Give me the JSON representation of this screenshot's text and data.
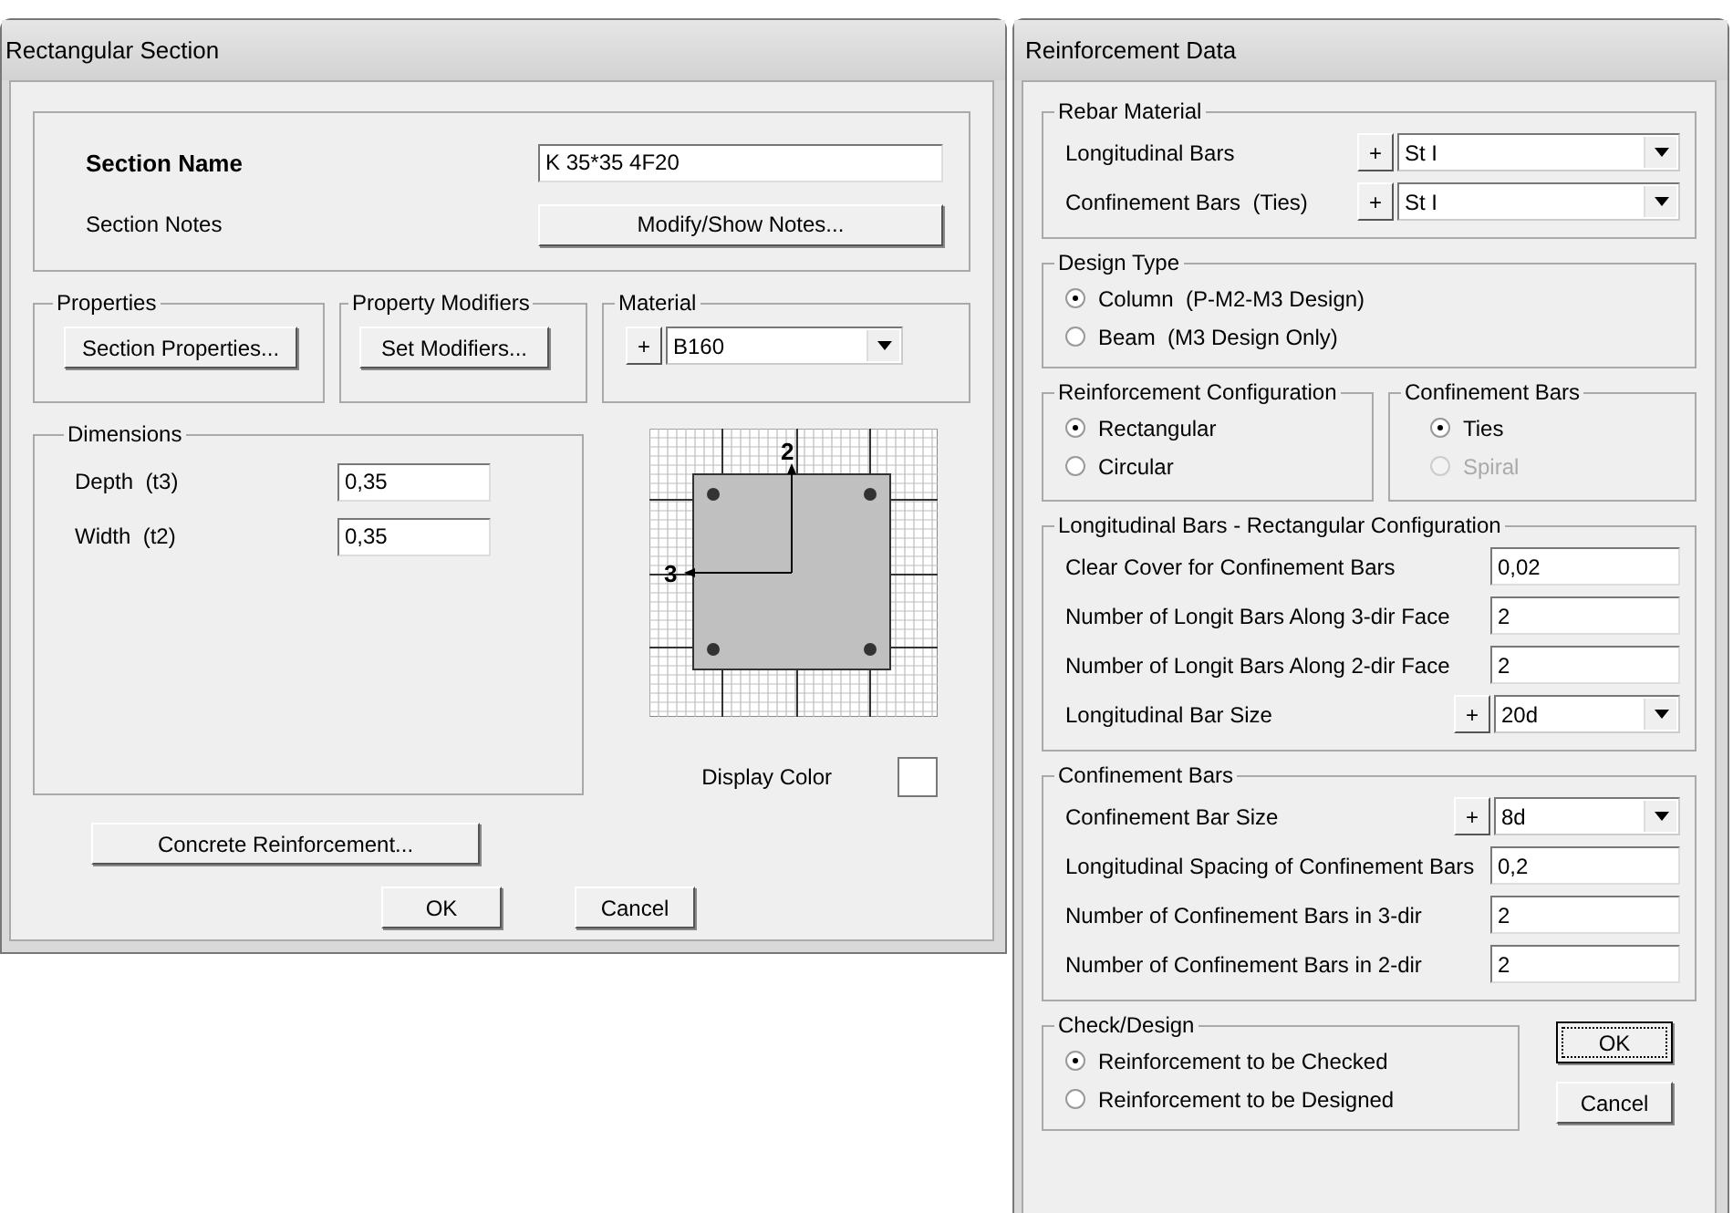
{
  "section_dialog": {
    "title": "Rectangular Section",
    "section_name": {
      "label": "Section Name",
      "value": "K 35*35 4F20"
    },
    "section_notes": {
      "label": "Section Notes",
      "button": "Modify/Show Notes..."
    },
    "properties": {
      "title": "Properties",
      "button": "Section Properties..."
    },
    "property_modifiers": {
      "title": "Property Modifiers",
      "button": "Set Modifiers..."
    },
    "material": {
      "title": "Material",
      "add": "+",
      "value": "B160"
    },
    "dimensions": {
      "title": "Dimensions",
      "fields": [
        {
          "label": "Depth  (t3)",
          "value": "0,35"
        },
        {
          "label": "Width  (t2)",
          "value": "0,35"
        }
      ]
    },
    "diagram": {
      "axis_2": "2",
      "axis_3": "3"
    },
    "display_color": {
      "label": "Display Color"
    },
    "reinforcement_button": "Concrete Reinforcement...",
    "buttons": [
      "OK",
      "Cancel"
    ]
  },
  "reinforcement_dialog": {
    "title": "Reinforcement Data",
    "rebar_material": {
      "title": "Rebar Material",
      "rows": [
        {
          "label": "Longitudinal Bars",
          "add": "+",
          "value": "St I"
        },
        {
          "label": "Confinement Bars  (Ties)",
          "add": "+",
          "value": "St I"
        }
      ]
    },
    "design_type": {
      "title": "Design Type",
      "options": [
        {
          "label": "Column  (P-M2-M3 Design)",
          "selected": true
        },
        {
          "label": "Beam  (M3 Design Only)",
          "selected": false
        }
      ]
    },
    "reinforcement_configuration": {
      "title": "Reinforcement Configuration",
      "options": [
        {
          "label": "Rectangular",
          "selected": true
        },
        {
          "label": "Circular",
          "selected": false
        }
      ]
    },
    "confinement_type": {
      "title": "Confinement Bars",
      "options": [
        {
          "label": "Ties",
          "selected": true,
          "disabled": false
        },
        {
          "label": "Spiral",
          "selected": false,
          "disabled": true
        }
      ]
    },
    "longitudinal_bars": {
      "title": "Longitudinal Bars - Rectangular Configuration",
      "rows": [
        {
          "kind": "field",
          "label": "Clear Cover for Confinement Bars",
          "value": "0,02"
        },
        {
          "kind": "field",
          "label": "Number of Longit Bars Along 3-dir Face",
          "value": "2"
        },
        {
          "kind": "field",
          "label": "Number of Longit Bars Along 2-dir Face",
          "value": "2"
        },
        {
          "kind": "dropdown",
          "label": "Longitudinal Bar Size",
          "add": "+",
          "value": "20d"
        }
      ]
    },
    "confinement_bars": {
      "title": "Confinement Bars",
      "rows": [
        {
          "kind": "dropdown",
          "label": "Confinement Bar Size",
          "add": "+",
          "value": "8d"
        },
        {
          "kind": "field",
          "label": "Longitudinal Spacing of Confinement Bars",
          "value": "0,2"
        },
        {
          "kind": "field",
          "label": "Number of Confinement Bars in 3-dir",
          "value": "2"
        },
        {
          "kind": "field",
          "label": "Number of Confinement Bars in 2-dir",
          "value": "2"
        }
      ]
    },
    "check_design": {
      "title": "Check/Design",
      "options": [
        {
          "label": "Reinforcement to be Checked",
          "selected": true
        },
        {
          "label": "Reinforcement to be Designed",
          "selected": false
        }
      ]
    },
    "buttons": [
      {
        "label": "OK",
        "focused": true
      },
      {
        "label": "Cancel",
        "focused": false
      }
    ]
  }
}
